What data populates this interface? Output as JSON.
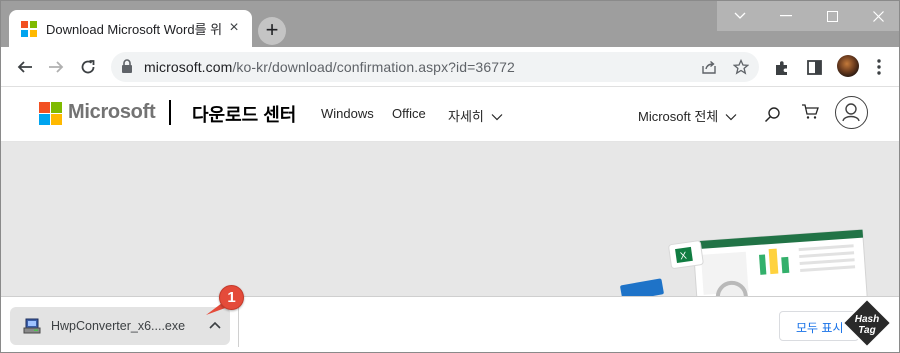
{
  "browser": {
    "tab": {
      "title": "Download Microsoft Word를 위"
    },
    "new_tab_label": "+",
    "window_controls": {
      "minimize": "⌄",
      "maximize": "—",
      "restore": "☐",
      "close": "✕"
    },
    "url_host": "microsoft.com",
    "url_path": "/ko-kr/download/confirmation.aspx?id=36772"
  },
  "site": {
    "brand": "Microsoft",
    "section_title": "다운로드 센터",
    "nav": [
      "Windows",
      "Office",
      "자세히"
    ],
    "all_microsoft": "Microsoft 전체"
  },
  "download_bar": {
    "file_name": "HwpConverter_x6....exe",
    "show_all": "모두 표시"
  },
  "annotation": {
    "badge": "1"
  },
  "watermark": {
    "line1": "Hash",
    "line2": "Tag"
  },
  "colors": {
    "ms_red": "#f25022",
    "ms_green": "#7fba00",
    "ms_blue": "#00a4ef",
    "ms_yellow": "#ffb900",
    "badge": "#e44b3a",
    "link_blue": "#1a73e8"
  }
}
